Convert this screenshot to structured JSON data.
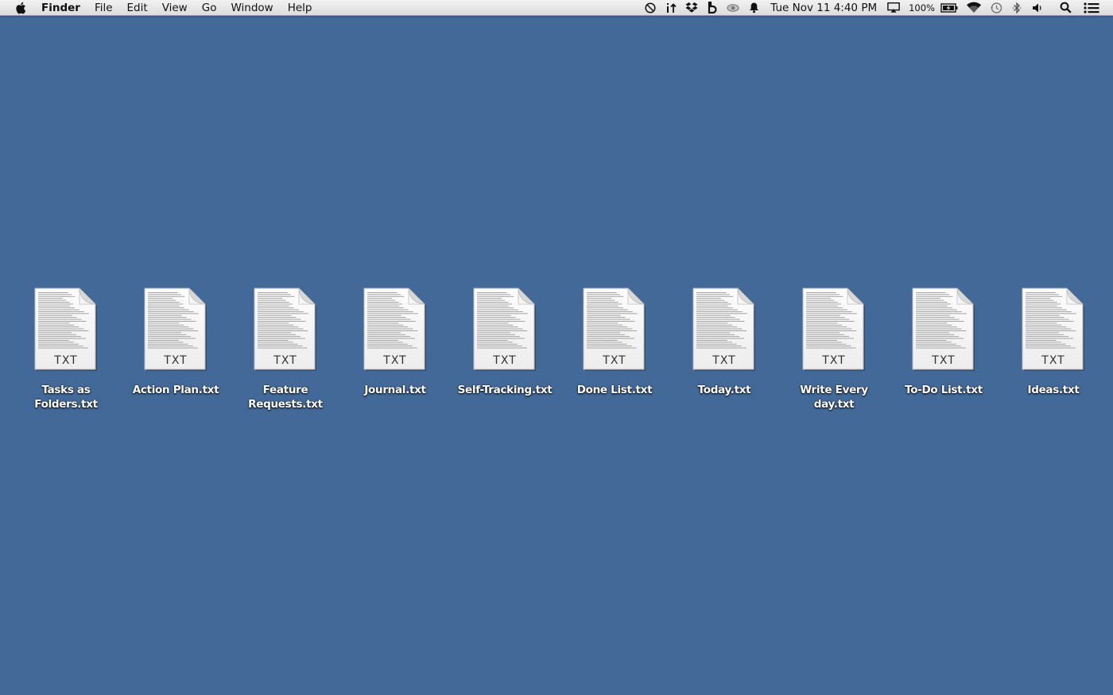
{
  "menubar": {
    "apple_icon": "apple-logo-icon",
    "app_name": "Finder",
    "menus": [
      "File",
      "Edit",
      "View",
      "Go",
      "Window",
      "Help"
    ],
    "status_icons": [
      "do-not-disturb-icon",
      "sync-arrows-icon",
      "dropbox-icon",
      "b-app-icon",
      "eye-icon",
      "notification-bell-icon"
    ],
    "clock": "Tue Nov 11  4:40 PM",
    "airplay_icon": "airplay-icon",
    "battery_percent": "100%",
    "battery_icon": "battery-charging-icon",
    "wifi_icon": "wifi-icon",
    "time_machine_icon": "time-machine-icon",
    "bluetooth_icon": "bluetooth-icon",
    "volume_icon": "volume-icon",
    "search_icon": "spotlight-search-icon",
    "notification_center_icon": "notification-center-list-icon"
  },
  "desktop": {
    "background_color": "#436998",
    "files": [
      {
        "name": "Tasks as Folders.txt",
        "ext": "TXT"
      },
      {
        "name": "Action Plan.txt",
        "ext": "TXT"
      },
      {
        "name": "Feature Requests.txt",
        "ext": "TXT"
      },
      {
        "name": "Journal.txt",
        "ext": "TXT"
      },
      {
        "name": "Self-Tracking.txt",
        "ext": "TXT"
      },
      {
        "name": "Done List.txt",
        "ext": "TXT"
      },
      {
        "name": "Today.txt",
        "ext": "TXT"
      },
      {
        "name": "Write Every day.txt",
        "ext": "TXT"
      },
      {
        "name": "To-Do List.txt",
        "ext": "TXT"
      },
      {
        "name": "Ideas.txt",
        "ext": "TXT"
      }
    ]
  }
}
